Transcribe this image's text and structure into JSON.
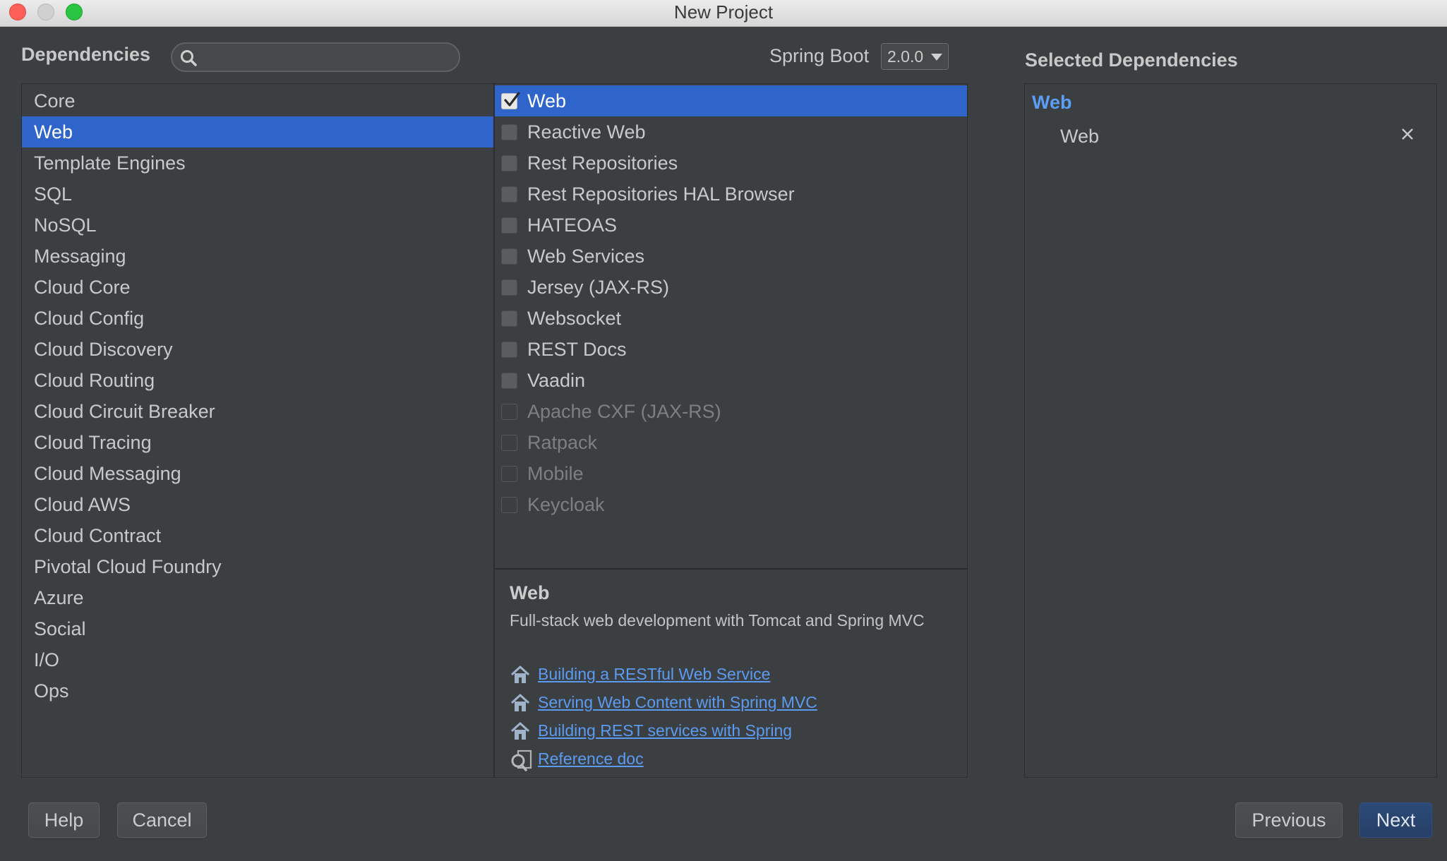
{
  "window": {
    "title": "New Project"
  },
  "header": {
    "dependencies_label": "Dependencies",
    "search": {
      "value": "",
      "placeholder": ""
    },
    "spring_boot_label": "Spring Boot",
    "spring_boot_version": "2.0.0"
  },
  "categories": {
    "selected": "Web",
    "items": [
      "Core",
      "Web",
      "Template Engines",
      "SQL",
      "NoSQL",
      "Messaging",
      "Cloud Core",
      "Cloud Config",
      "Cloud Discovery",
      "Cloud Routing",
      "Cloud Circuit Breaker",
      "Cloud Tracing",
      "Cloud Messaging",
      "Cloud AWS",
      "Cloud Contract",
      "Pivotal Cloud Foundry",
      "Azure",
      "Social",
      "I/O",
      "Ops"
    ]
  },
  "dependencies": {
    "items": [
      {
        "label": "Web",
        "checked": true,
        "enabled": true
      },
      {
        "label": "Reactive Web",
        "checked": false,
        "enabled": true
      },
      {
        "label": "Rest Repositories",
        "checked": false,
        "enabled": true
      },
      {
        "label": "Rest Repositories HAL Browser",
        "checked": false,
        "enabled": true
      },
      {
        "label": "HATEOAS",
        "checked": false,
        "enabled": true
      },
      {
        "label": "Web Services",
        "checked": false,
        "enabled": true
      },
      {
        "label": "Jersey (JAX-RS)",
        "checked": false,
        "enabled": true
      },
      {
        "label": "Websocket",
        "checked": false,
        "enabled": true
      },
      {
        "label": "REST Docs",
        "checked": false,
        "enabled": true
      },
      {
        "label": "Vaadin",
        "checked": false,
        "enabled": true
      },
      {
        "label": "Apache CXF (JAX-RS)",
        "checked": false,
        "enabled": false
      },
      {
        "label": "Ratpack",
        "checked": false,
        "enabled": false
      },
      {
        "label": "Mobile",
        "checked": false,
        "enabled": false
      },
      {
        "label": "Keycloak",
        "checked": false,
        "enabled": false
      }
    ]
  },
  "description": {
    "title": "Web",
    "text": "Full-stack web development with Tomcat and Spring MVC",
    "links": [
      {
        "label": "Building a RESTful Web Service",
        "icon": "home-icon"
      },
      {
        "label": "Serving Web Content with Spring MVC",
        "icon": "home-icon"
      },
      {
        "label": "Building REST services with Spring",
        "icon": "home-icon"
      },
      {
        "label": "Reference doc",
        "icon": "doc-search-icon"
      }
    ]
  },
  "selected_dependencies": {
    "title": "Selected Dependencies",
    "groups": [
      {
        "name": "Web",
        "items": [
          "Web"
        ]
      }
    ]
  },
  "footer": {
    "help_label": "Help",
    "cancel_label": "Cancel",
    "previous_label": "Previous",
    "next_label": "Next"
  },
  "colors": {
    "background": "#3c3f41",
    "selection": "#2f65ca",
    "link": "#5b9bf1",
    "group_accent": "#5a9ff5"
  }
}
